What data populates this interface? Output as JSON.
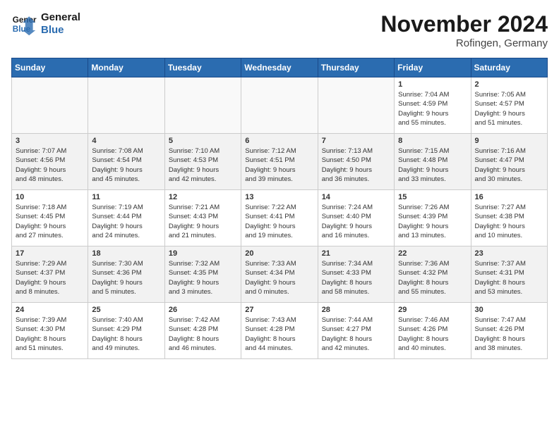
{
  "logo": {
    "line1": "General",
    "line2": "Blue"
  },
  "title": "November 2024",
  "location": "Rofingen, Germany",
  "weekdays": [
    "Sunday",
    "Monday",
    "Tuesday",
    "Wednesday",
    "Thursday",
    "Friday",
    "Saturday"
  ],
  "weeks": [
    [
      {
        "day": "",
        "info": ""
      },
      {
        "day": "",
        "info": ""
      },
      {
        "day": "",
        "info": ""
      },
      {
        "day": "",
        "info": ""
      },
      {
        "day": "",
        "info": ""
      },
      {
        "day": "1",
        "info": "Sunrise: 7:04 AM\nSunset: 4:59 PM\nDaylight: 9 hours\nand 55 minutes."
      },
      {
        "day": "2",
        "info": "Sunrise: 7:05 AM\nSunset: 4:57 PM\nDaylight: 9 hours\nand 51 minutes."
      }
    ],
    [
      {
        "day": "3",
        "info": "Sunrise: 7:07 AM\nSunset: 4:56 PM\nDaylight: 9 hours\nand 48 minutes."
      },
      {
        "day": "4",
        "info": "Sunrise: 7:08 AM\nSunset: 4:54 PM\nDaylight: 9 hours\nand 45 minutes."
      },
      {
        "day": "5",
        "info": "Sunrise: 7:10 AM\nSunset: 4:53 PM\nDaylight: 9 hours\nand 42 minutes."
      },
      {
        "day": "6",
        "info": "Sunrise: 7:12 AM\nSunset: 4:51 PM\nDaylight: 9 hours\nand 39 minutes."
      },
      {
        "day": "7",
        "info": "Sunrise: 7:13 AM\nSunset: 4:50 PM\nDaylight: 9 hours\nand 36 minutes."
      },
      {
        "day": "8",
        "info": "Sunrise: 7:15 AM\nSunset: 4:48 PM\nDaylight: 9 hours\nand 33 minutes."
      },
      {
        "day": "9",
        "info": "Sunrise: 7:16 AM\nSunset: 4:47 PM\nDaylight: 9 hours\nand 30 minutes."
      }
    ],
    [
      {
        "day": "10",
        "info": "Sunrise: 7:18 AM\nSunset: 4:45 PM\nDaylight: 9 hours\nand 27 minutes."
      },
      {
        "day": "11",
        "info": "Sunrise: 7:19 AM\nSunset: 4:44 PM\nDaylight: 9 hours\nand 24 minutes."
      },
      {
        "day": "12",
        "info": "Sunrise: 7:21 AM\nSunset: 4:43 PM\nDaylight: 9 hours\nand 21 minutes."
      },
      {
        "day": "13",
        "info": "Sunrise: 7:22 AM\nSunset: 4:41 PM\nDaylight: 9 hours\nand 19 minutes."
      },
      {
        "day": "14",
        "info": "Sunrise: 7:24 AM\nSunset: 4:40 PM\nDaylight: 9 hours\nand 16 minutes."
      },
      {
        "day": "15",
        "info": "Sunrise: 7:26 AM\nSunset: 4:39 PM\nDaylight: 9 hours\nand 13 minutes."
      },
      {
        "day": "16",
        "info": "Sunrise: 7:27 AM\nSunset: 4:38 PM\nDaylight: 9 hours\nand 10 minutes."
      }
    ],
    [
      {
        "day": "17",
        "info": "Sunrise: 7:29 AM\nSunset: 4:37 PM\nDaylight: 9 hours\nand 8 minutes."
      },
      {
        "day": "18",
        "info": "Sunrise: 7:30 AM\nSunset: 4:36 PM\nDaylight: 9 hours\nand 5 minutes."
      },
      {
        "day": "19",
        "info": "Sunrise: 7:32 AM\nSunset: 4:35 PM\nDaylight: 9 hours\nand 3 minutes."
      },
      {
        "day": "20",
        "info": "Sunrise: 7:33 AM\nSunset: 4:34 PM\nDaylight: 9 hours\nand 0 minutes."
      },
      {
        "day": "21",
        "info": "Sunrise: 7:34 AM\nSunset: 4:33 PM\nDaylight: 8 hours\nand 58 minutes."
      },
      {
        "day": "22",
        "info": "Sunrise: 7:36 AM\nSunset: 4:32 PM\nDaylight: 8 hours\nand 55 minutes."
      },
      {
        "day": "23",
        "info": "Sunrise: 7:37 AM\nSunset: 4:31 PM\nDaylight: 8 hours\nand 53 minutes."
      }
    ],
    [
      {
        "day": "24",
        "info": "Sunrise: 7:39 AM\nSunset: 4:30 PM\nDaylight: 8 hours\nand 51 minutes."
      },
      {
        "day": "25",
        "info": "Sunrise: 7:40 AM\nSunset: 4:29 PM\nDaylight: 8 hours\nand 49 minutes."
      },
      {
        "day": "26",
        "info": "Sunrise: 7:42 AM\nSunset: 4:28 PM\nDaylight: 8 hours\nand 46 minutes."
      },
      {
        "day": "27",
        "info": "Sunrise: 7:43 AM\nSunset: 4:28 PM\nDaylight: 8 hours\nand 44 minutes."
      },
      {
        "day": "28",
        "info": "Sunrise: 7:44 AM\nSunset: 4:27 PM\nDaylight: 8 hours\nand 42 minutes."
      },
      {
        "day": "29",
        "info": "Sunrise: 7:46 AM\nSunset: 4:26 PM\nDaylight: 8 hours\nand 40 minutes."
      },
      {
        "day": "30",
        "info": "Sunrise: 7:47 AM\nSunset: 4:26 PM\nDaylight: 8 hours\nand 38 minutes."
      }
    ]
  ]
}
